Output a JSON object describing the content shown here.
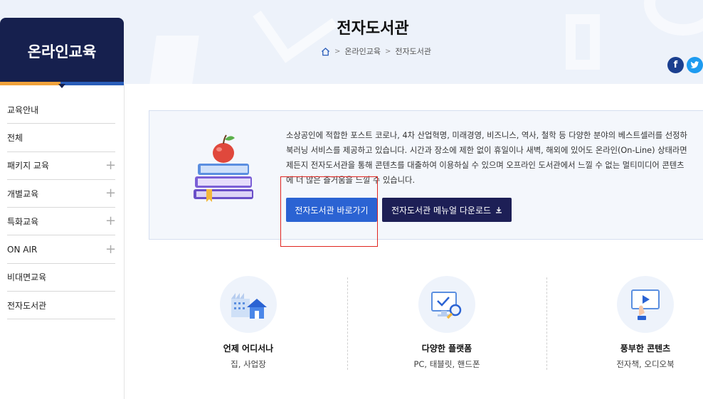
{
  "header": {
    "title": "전자도서관",
    "breadcrumb": [
      "온라인교육",
      "전자도서관"
    ]
  },
  "sns": {
    "facebook_label": "f"
  },
  "sidebar": {
    "title": "온라인교육",
    "items": [
      {
        "label": "교육안내",
        "expandable": false
      },
      {
        "label": "전체",
        "expandable": false
      },
      {
        "label": "패키지 교육",
        "expandable": true
      },
      {
        "label": "개별교육",
        "expandable": true
      },
      {
        "label": "특화교육",
        "expandable": true
      },
      {
        "label": "ON AIR",
        "expandable": true
      },
      {
        "label": "비대면교육",
        "expandable": false
      },
      {
        "label": "전자도서관",
        "expandable": false
      }
    ]
  },
  "intro": {
    "lines": [
      "소상공인에 적합한 포스트 코로나, 4차 산업혁명, 미래경영, 비즈니스, 역사, 철학 등 다양한 분야의 베스트셀러를 선정하",
      "북러닝 서비스를 제공하고 있습니다. 시간과 장소에 제한 없이 휴일이나 새벽, 해외에 있어도 온라인(On-Line) 상태라면",
      "제든지 전자도서관을 통해 콘텐츠를 대출하여 이용하실 수 있으며 오프라인 도서관에서 느낄 수 없는 멀티미디어 콘텐츠",
      "에 더 많은 즐거움을 느낄 수 있습니다."
    ],
    "go_button": "전자도서관 바로가기",
    "manual_button": "전자도서관 메뉴얼 다운로드"
  },
  "features": [
    {
      "title": "언제 어디서나",
      "subtitle": "집, 사업장"
    },
    {
      "title": "다양한 플랫폼",
      "subtitle": "PC, 태블릿, 핸드폰"
    },
    {
      "title": "풍부한 콘텐츠",
      "subtitle": "전자책, 오디오북"
    }
  ],
  "colors": {
    "sidebar_head": "#16204e",
    "primary_button": "#2b63d3",
    "dark_button": "#1d1f56",
    "highlight_box": "#e0241f"
  }
}
